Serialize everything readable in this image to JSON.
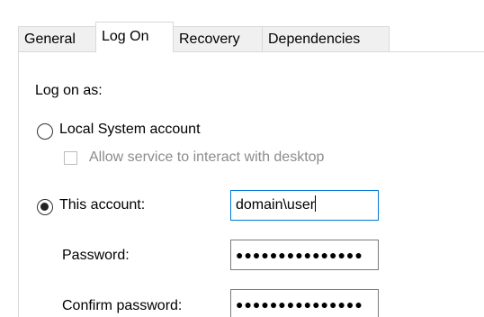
{
  "tabs": [
    {
      "label": "General"
    },
    {
      "label": "Log On"
    },
    {
      "label": "Recovery"
    },
    {
      "label": "Dependencies"
    }
  ],
  "active_tab": "Log On",
  "logon": {
    "heading": "Log on as:",
    "local_system_label": "Local System account",
    "allow_desktop_label": "Allow service to interact with desktop",
    "this_account_label": "This account:",
    "account_value": "domain\\user",
    "password_label": "Password:",
    "password_mask": "●●●●●●●●●●●●●●●",
    "confirm_label": "Confirm password:",
    "confirm_mask": "●●●●●●●●●●●●●●●",
    "selected_option": "This account",
    "allow_desktop_checked": false,
    "allow_desktop_enabled": false
  },
  "colors": {
    "focus_border": "#0078d7",
    "disabled_text": "#8c8c8c"
  }
}
